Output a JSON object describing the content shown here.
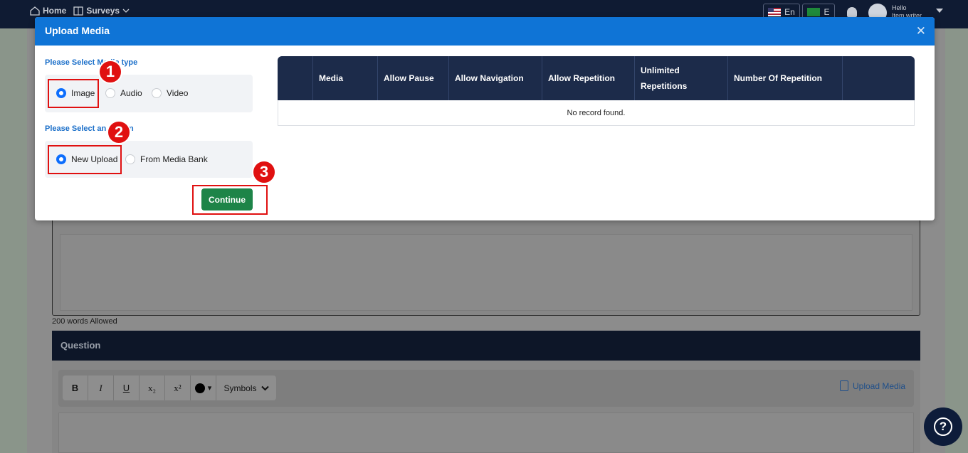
{
  "topbar": {
    "nav": [
      {
        "label": "Home",
        "icon": "home-icon"
      },
      {
        "label": "Surveys",
        "icon": "survey-icon"
      }
    ],
    "language": "En",
    "language2": "E",
    "greeting": "Hello",
    "username": "Item writer"
  },
  "background": {
    "words_allowed": "200 words Allowed",
    "question_heading": "Question",
    "toolbar": {
      "bold": "B",
      "italic": "I",
      "underline": "U",
      "subscript": "x₂",
      "superscript": "x²",
      "color_caret": "▾",
      "symbols": "Symbols"
    },
    "upload_media_link": "Upload Media",
    "help_icon_glyph": "?"
  },
  "modal": {
    "title": "Upload Media",
    "close_glyph": "✕",
    "media_type_label": "Please Select Media type",
    "media_types": [
      {
        "label": "Image",
        "selected": true
      },
      {
        "label": "Audio",
        "selected": false
      },
      {
        "label": "Video",
        "selected": false
      }
    ],
    "option_label": "Please Select an Option",
    "options": [
      {
        "label": "New Upload",
        "selected": true
      },
      {
        "label": "From Media Bank",
        "selected": false
      }
    ],
    "continue_label": "Continue",
    "table": {
      "columns": [
        "",
        "Media",
        "Allow Pause",
        "Allow Navigation",
        "Allow Repetition",
        "Unlimited Repetitions",
        "Number Of Repetition",
        ""
      ],
      "empty_text": "No record found."
    }
  },
  "annotations": {
    "badges": [
      "1",
      "2",
      "3"
    ],
    "color": "#e01010"
  },
  "colors": {
    "modal_header": "#0f74d6",
    "continue_button": "#1d8448",
    "table_header": "#1c2b4a",
    "label_blue": "#1b6fc9"
  }
}
